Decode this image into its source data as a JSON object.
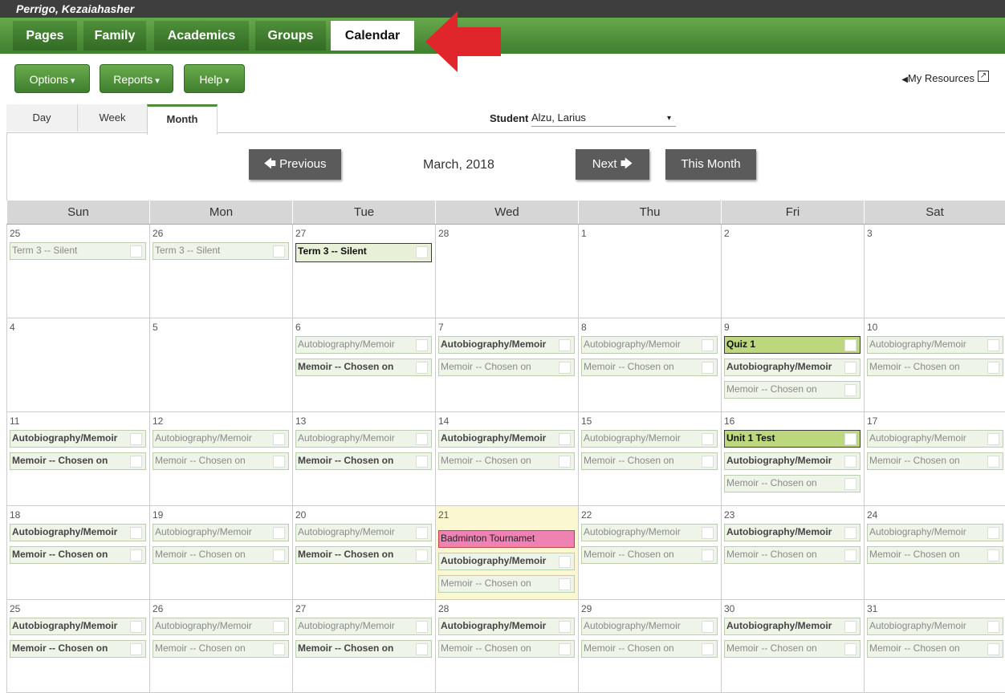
{
  "user": {
    "name": "Perrigo, Kezaiahasher"
  },
  "nav": {
    "tabs": [
      {
        "label": "Pages"
      },
      {
        "label": "Family"
      },
      {
        "label": "Academics"
      },
      {
        "label": "Groups"
      },
      {
        "label": "Calendar"
      }
    ]
  },
  "toolbar": {
    "options": "Options",
    "reports": "Reports",
    "help": "Help",
    "my_resources": "My Resources",
    "caret": "▾",
    "left_tri": "◀"
  },
  "views": {
    "day": "Day",
    "week": "Week",
    "month": "Month"
  },
  "student": {
    "label": "Student",
    "value": "Alzu, Larius",
    "arrow": "▾"
  },
  "monthnav": {
    "previous": "Previous",
    "title": "March, 2018",
    "next": "Next",
    "this_month": "This Month",
    "prev_arrow": "🡄",
    "next_arrow": "🡆"
  },
  "weekdays": [
    "Sun",
    "Mon",
    "Tue",
    "Wed",
    "Thu",
    "Fri",
    "Sat"
  ],
  "weeks": [
    [
      "25",
      "26",
      "27",
      "28",
      "1",
      "2",
      "3"
    ],
    [
      "4",
      "5",
      "6",
      "7",
      "8",
      "9",
      "10"
    ],
    [
      "11",
      "12",
      "13",
      "14",
      "15",
      "16",
      "17"
    ],
    [
      "18",
      "19",
      "20",
      "21",
      "22",
      "23",
      "24"
    ],
    [
      "25",
      "26",
      "27",
      "28",
      "29",
      "30",
      "31"
    ]
  ],
  "events": {
    "term": "Term 3 -- Silent",
    "auto": "Autobiography/Memoir",
    "memoir": "Memoir -- Chosen on",
    "quiz": "Quiz 1",
    "unit": "Unit 1 Test",
    "badminton": "Badminton Tournamet"
  }
}
